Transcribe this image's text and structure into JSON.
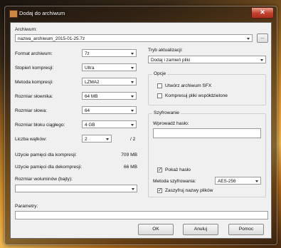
{
  "window": {
    "title": "Dodaj do archiwum",
    "close_glyph": "✕"
  },
  "archive": {
    "label": "Archiwum:",
    "value": "nazwa_archiwum_2015-01-25.7z",
    "browse_label": "..."
  },
  "left": {
    "format": {
      "label": "Format archiwum:",
      "value": "7z"
    },
    "level": {
      "label": "Stopień kompresji:",
      "value": "Ultra"
    },
    "method": {
      "label": "Metoda kompresji:",
      "value": "LZMA2"
    },
    "dict": {
      "label": "Rozmiar słownika:",
      "value": "64 MB"
    },
    "word": {
      "label": "Rozmiar słowa:",
      "value": "64"
    },
    "block": {
      "label": "Rozmiar bloku ciągłego:",
      "value": "4 GB"
    },
    "threads": {
      "label": "Liczba wątków:",
      "value": "2",
      "max": "/ 2"
    },
    "mem_comp": {
      "label": "Użycie pamięci dla kompresji:",
      "value": "709 MB"
    },
    "mem_decomp": {
      "label": "Użycie pamięci dla dekompresji:",
      "value": "66 MB"
    },
    "volumes": {
      "label": "Rozmiar woluminów (bajty):",
      "value": ""
    },
    "params": {
      "label": "Parametry:",
      "value": ""
    }
  },
  "right": {
    "update": {
      "label": "Tryb aktualizacji:",
      "value": "Dodaj i zamień pliki"
    },
    "options": {
      "title": "Opcje",
      "sfx": "Utwórz archiwum SFX",
      "shared": "Kompresuj pliki współdzielone"
    },
    "encryption": {
      "title": "Szyfrowanie",
      "password_label": "Wprowadź hasło:",
      "show_password": "Pokaż hasło",
      "method_label": "Metoda szyfrowania:",
      "method_value": "AES-256",
      "encrypt_names": "Zaszyfruj nazwy plików"
    }
  },
  "checks": {
    "sfx": false,
    "shared": false,
    "show_password": true,
    "encrypt_names": true,
    "mark": "✓"
  },
  "buttons": {
    "ok": "OK",
    "cancel": "Anuluj",
    "help": "Pomoc"
  }
}
